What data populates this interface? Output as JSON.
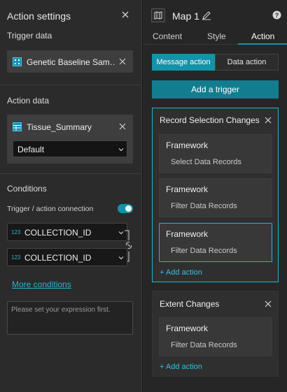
{
  "left_panel": {
    "title": "Action settings",
    "trigger_section": {
      "label": "Trigger data",
      "source_name": "Genetic Baseline Sam…"
    },
    "action_section": {
      "label": "Action data",
      "source_name": "Tissue_Summary",
      "view_select": "Default"
    },
    "conditions": {
      "label": "Conditions",
      "connection_label": "Trigger / action connection",
      "connection_enabled": true,
      "trigger_field_type": "123",
      "trigger_field": "COLLECTION_ID",
      "action_field_type": "123",
      "action_field": "COLLECTION_ID",
      "more_link": "More conditions",
      "expression_placeholder": "Please set your expression first."
    }
  },
  "right_panel": {
    "title": "Map 1",
    "tabs": [
      {
        "label": "Content",
        "active": false
      },
      {
        "label": "Style",
        "active": false
      },
      {
        "label": "Action",
        "active": true
      }
    ],
    "action_types": {
      "message": "Message action",
      "data": "Data action",
      "selected": "message"
    },
    "add_trigger_label": "Add a trigger",
    "groups": [
      {
        "title": "Record Selection Changes",
        "actions": [
          {
            "title": "Framework",
            "description": "Select Data Records",
            "selected": false
          },
          {
            "title": "Framework",
            "description": "Filter Data Records",
            "selected": false
          },
          {
            "title": "Framework",
            "description": "Filter Data Records",
            "selected": true
          }
        ],
        "add_action_label": "+ Add action"
      },
      {
        "title": "Extent Changes",
        "actions": [
          {
            "title": "Framework",
            "description": "Filter Data Records",
            "selected": false
          }
        ],
        "add_action_label": "+ Add action"
      }
    ]
  },
  "colors": {
    "accent": "#1492a8",
    "link": "#2bb3d3",
    "panel_bg": "#2b2b2b",
    "selected_border": "#23b3d5"
  }
}
